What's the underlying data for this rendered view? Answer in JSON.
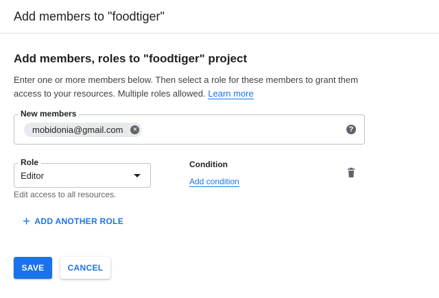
{
  "dialog": {
    "title": "Add members to \"foodtiger\""
  },
  "section": {
    "title": "Add members, roles to \"foodtiger\" project",
    "description": "Enter one or more members below. Then select a role for these members to grant them access to your resources. Multiple roles allowed.",
    "learn_more": "Learn more"
  },
  "members": {
    "label": "New members",
    "chips": [
      "mobidonia@gmail.com"
    ],
    "help_icon": "?"
  },
  "role": {
    "label": "Role",
    "selected": "Editor",
    "hint": "Edit access to all resources."
  },
  "condition": {
    "label": "Condition",
    "add_link": "Add condition"
  },
  "add_role": {
    "icon": "+",
    "label": "ADD ANOTHER ROLE"
  },
  "actions": {
    "save": "SAVE",
    "cancel": "CANCEL"
  },
  "colors": {
    "accent": "#1a73e8",
    "chip_bg": "#e8eaed",
    "icon_gray": "#5f6368"
  }
}
